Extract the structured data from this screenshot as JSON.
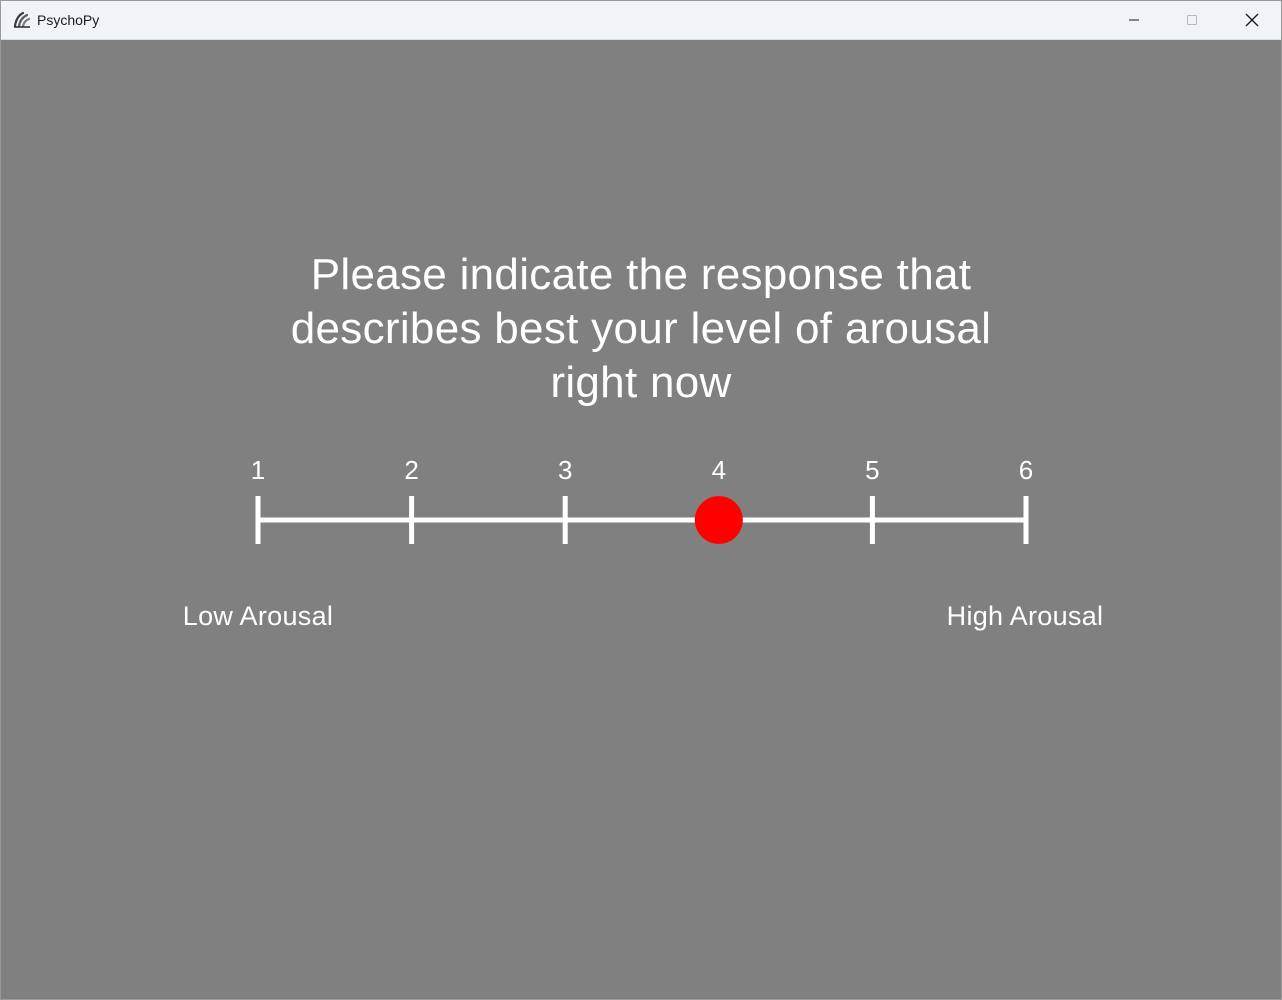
{
  "window": {
    "title": "PsychoPy",
    "icon": "psychopy-logo-icon"
  },
  "window_controls": {
    "minimize": "minimize-icon",
    "maximize": "maximize-icon",
    "close": "close-icon"
  },
  "colors": {
    "background": "#808080",
    "text": "#ffffff",
    "marker": "#ff0000",
    "scale_line": "#ffffff"
  },
  "question": {
    "text": "Please indicate the response that describes best your level of arousal right now"
  },
  "rating_scale": {
    "ticks": [
      "1",
      "2",
      "3",
      "4",
      "5",
      "6"
    ],
    "selected_value": 4,
    "low_anchor": "Low Arousal",
    "high_anchor": "High Arousal"
  }
}
